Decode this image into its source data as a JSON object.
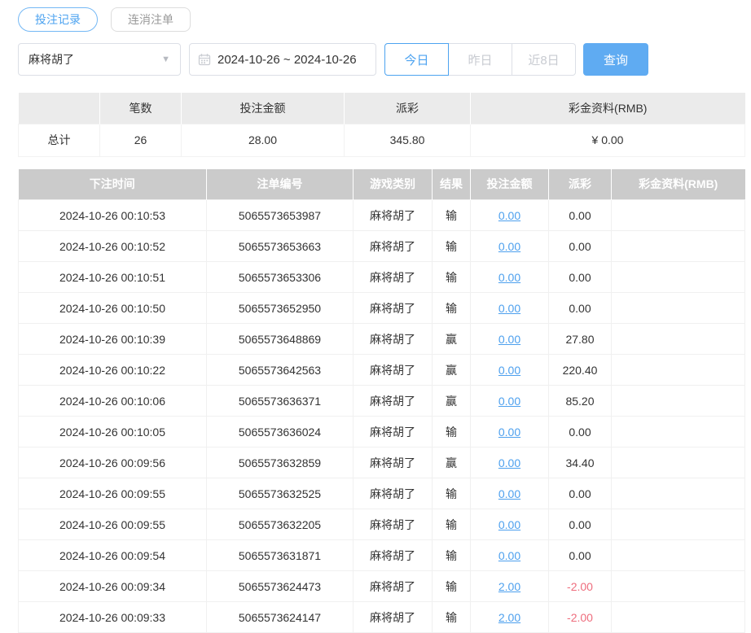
{
  "tabs": [
    {
      "label": "投注记录",
      "active": true
    },
    {
      "label": "连消注单",
      "active": false
    }
  ],
  "filters": {
    "game_select": {
      "value": "麻将胡了"
    },
    "date_range": "2024-10-26 ~ 2024-10-26",
    "quick_ranges": [
      {
        "label": "今日",
        "active": true
      },
      {
        "label": "昨日",
        "active": false
      },
      {
        "label": "近8日",
        "active": false
      }
    ],
    "search_label": "查询"
  },
  "summary": {
    "headers": [
      "",
      "笔数",
      "投注金额",
      "派彩",
      "彩金资料(RMB)"
    ],
    "row": {
      "label": "总计",
      "count": "26",
      "bet_amount": "28.00",
      "payout": "345.80",
      "bonus": "¥ 0.00"
    }
  },
  "records": {
    "headers": [
      "下注时间",
      "注单编号",
      "游戏类别",
      "结果",
      "投注金额",
      "派彩",
      "彩金资料(RMB)"
    ],
    "rows": [
      {
        "time": "2024-10-26 00:10:53",
        "order_no": "5065573653987",
        "game": "麻将胡了",
        "result": "输",
        "bet": "0.00",
        "payout": "0.00",
        "bonus": ""
      },
      {
        "time": "2024-10-26 00:10:52",
        "order_no": "5065573653663",
        "game": "麻将胡了",
        "result": "输",
        "bet": "0.00",
        "payout": "0.00",
        "bonus": ""
      },
      {
        "time": "2024-10-26 00:10:51",
        "order_no": "5065573653306",
        "game": "麻将胡了",
        "result": "输",
        "bet": "0.00",
        "payout": "0.00",
        "bonus": ""
      },
      {
        "time": "2024-10-26 00:10:50",
        "order_no": "5065573652950",
        "game": "麻将胡了",
        "result": "输",
        "bet": "0.00",
        "payout": "0.00",
        "bonus": ""
      },
      {
        "time": "2024-10-26 00:10:39",
        "order_no": "5065573648869",
        "game": "麻将胡了",
        "result": "赢",
        "bet": "0.00",
        "payout": "27.80",
        "bonus": ""
      },
      {
        "time": "2024-10-26 00:10:22",
        "order_no": "5065573642563",
        "game": "麻将胡了",
        "result": "赢",
        "bet": "0.00",
        "payout": "220.40",
        "bonus": ""
      },
      {
        "time": "2024-10-26 00:10:06",
        "order_no": "5065573636371",
        "game": "麻将胡了",
        "result": "赢",
        "bet": "0.00",
        "payout": "85.20",
        "bonus": ""
      },
      {
        "time": "2024-10-26 00:10:05",
        "order_no": "5065573636024",
        "game": "麻将胡了",
        "result": "输",
        "bet": "0.00",
        "payout": "0.00",
        "bonus": ""
      },
      {
        "time": "2024-10-26 00:09:56",
        "order_no": "5065573632859",
        "game": "麻将胡了",
        "result": "赢",
        "bet": "0.00",
        "payout": "34.40",
        "bonus": ""
      },
      {
        "time": "2024-10-26 00:09:55",
        "order_no": "5065573632525",
        "game": "麻将胡了",
        "result": "输",
        "bet": "0.00",
        "payout": "0.00",
        "bonus": ""
      },
      {
        "time": "2024-10-26 00:09:55",
        "order_no": "5065573632205",
        "game": "麻将胡了",
        "result": "输",
        "bet": "0.00",
        "payout": "0.00",
        "bonus": ""
      },
      {
        "time": "2024-10-26 00:09:54",
        "order_no": "5065573631871",
        "game": "麻将胡了",
        "result": "输",
        "bet": "0.00",
        "payout": "0.00",
        "bonus": ""
      },
      {
        "time": "2024-10-26 00:09:34",
        "order_no": "5065573624473",
        "game": "麻将胡了",
        "result": "输",
        "bet": "2.00",
        "payout": "-2.00",
        "bonus": ""
      },
      {
        "time": "2024-10-26 00:09:33",
        "order_no": "5065573624147",
        "game": "麻将胡了",
        "result": "输",
        "bet": "2.00",
        "payout": "-2.00",
        "bonus": ""
      }
    ]
  },
  "colors": {
    "accent_blue": "#4da3f0",
    "button_blue": "#5fabf2",
    "link_blue": "#4da0ee",
    "negative_red": "#ee6d7d",
    "header_gray": "#cbcbcb",
    "summary_header_gray": "#ebebeb"
  }
}
